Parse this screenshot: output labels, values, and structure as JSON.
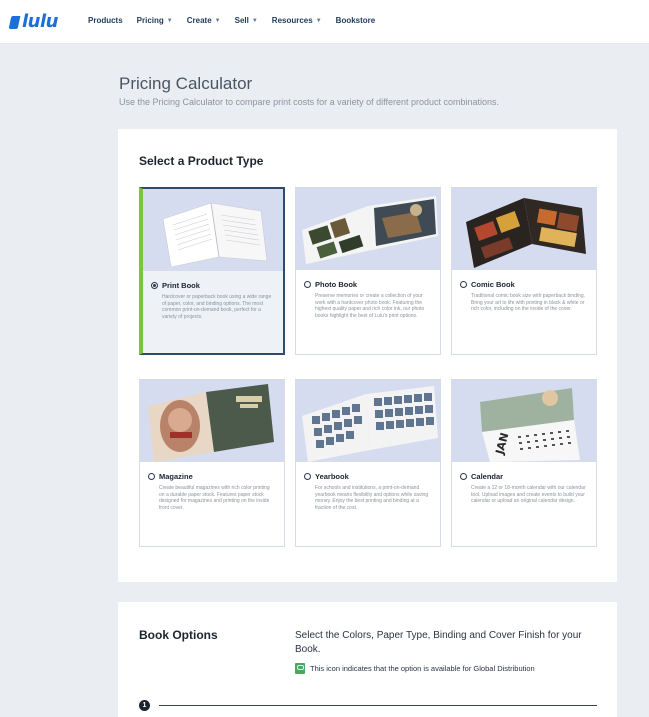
{
  "header": {
    "logo_text": "lulu",
    "nav": [
      {
        "label": "Products",
        "caret": false
      },
      {
        "label": "Pricing",
        "caret": true
      },
      {
        "label": "Create",
        "caret": true
      },
      {
        "label": "Sell",
        "caret": true
      },
      {
        "label": "Resources",
        "caret": true
      },
      {
        "label": "Bookstore",
        "caret": false
      }
    ]
  },
  "intro": {
    "title": "Pricing Calculator",
    "subtitle": "Use the Pricing Calculator to compare print costs for a variety of different product combinations."
  },
  "product_type": {
    "heading": "Select a Product Type",
    "cards": [
      {
        "name": "Print Book",
        "selected": true,
        "desc": "Hardcover or paperback book using a wide range of paper, color, and binding options. The most common print-on-demand book, perfect for a variety of projects."
      },
      {
        "name": "Photo Book",
        "selected": false,
        "desc": "Preserve memories or create a collection of your work with a hardcover photo book. Featuring the highest quality paper and rich color ink, our photo books highlight the best of Lulu's print options."
      },
      {
        "name": "Comic Book",
        "selected": false,
        "desc": "Traditional comic book size with paperback binding. Bring your art to life with printing in black & white or rich color, including on the inside of the cover."
      },
      {
        "name": "Magazine",
        "selected": false,
        "desc": "Create beautiful magazines with rich color printing on a durable paper stock. Features paper stock designed for magazines and printing on the inside front cover."
      },
      {
        "name": "Yearbook",
        "selected": false,
        "desc": "For schools and institutions, a print-on-demand yearbook means flexibility and options while saving money. Enjoy the best printing and binding at a fraction of the cost."
      },
      {
        "name": "Calendar",
        "selected": false,
        "desc": "Create a 12 or 18-month calendar with our calendar tool. Upload images and create events to build your calendar or upload an original calendar design."
      }
    ]
  },
  "book_options": {
    "heading": "Book Options",
    "description": "Select the Colors, Paper Type, Binding and Cover Finish for your Book.",
    "note": "This icon indicates that the option is available for Global Distribution",
    "step_number": "1"
  },
  "colors": {
    "brand": "#1c6fd8",
    "selected_accent": "#7fc241",
    "selected_border": "#2e4a6e",
    "page_bg": "#eaeef3"
  }
}
